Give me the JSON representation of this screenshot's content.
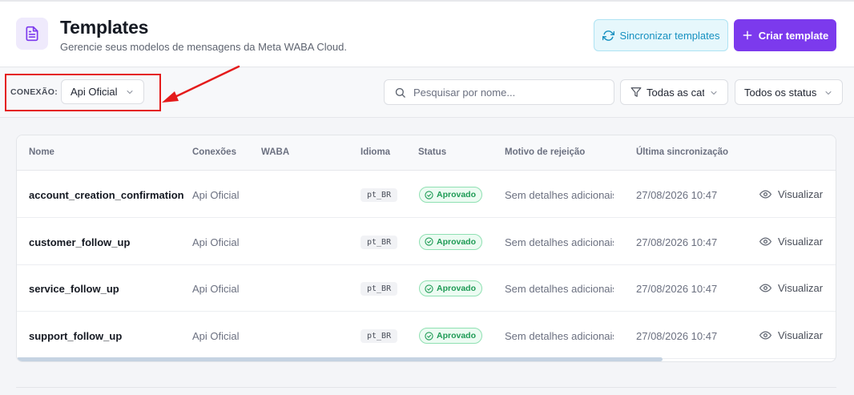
{
  "header": {
    "title": "Templates",
    "subtitle": "Gerencie seus modelos de mensagens da Meta WABA Cloud.",
    "sync_label": "Sincronizar templates",
    "create_label": "Criar template"
  },
  "toolbar": {
    "connection_label": "CONEXÃO:",
    "connection_value": "Api Oficial",
    "search_placeholder": "Pesquisar por nome...",
    "category_value": "Todas as categorias",
    "status_value": "Todos os status"
  },
  "annotation_color": "#e41b1b",
  "table": {
    "headers": {
      "name": "Nome",
      "connections": "Conexões",
      "waba": "WABA",
      "language": "Idioma",
      "status": "Status",
      "rejection": "Motivo de rejeição",
      "last_sync": "Última sincronização"
    },
    "rows": [
      {
        "name": "account_creation_confirmation",
        "connection": "Api Oficial",
        "waba": "",
        "language": "pt_BR",
        "status": "Aprovado",
        "reason": "Sem detalhes adicionais.",
        "last_sync": "27/08/2026 10:47",
        "action": "Visualizar"
      },
      {
        "name": "customer_follow_up",
        "connection": "Api Oficial",
        "waba": "",
        "language": "pt_BR",
        "status": "Aprovado",
        "reason": "Sem detalhes adicionais.",
        "last_sync": "27/08/2026 10:47",
        "action": "Visualizar"
      },
      {
        "name": "service_follow_up",
        "connection": "Api Oficial",
        "waba": "",
        "language": "pt_BR",
        "status": "Aprovado",
        "reason": "Sem detalhes adicionais.",
        "last_sync": "27/08/2026 10:47",
        "action": "Visualizar"
      },
      {
        "name": "support_follow_up",
        "connection": "Api Oficial",
        "waba": "",
        "language": "pt_BR",
        "status": "Aprovado",
        "reason": "Sem detalhes adicionais.",
        "last_sync": "27/08/2026 10:47",
        "action": "Visualizar"
      }
    ]
  }
}
